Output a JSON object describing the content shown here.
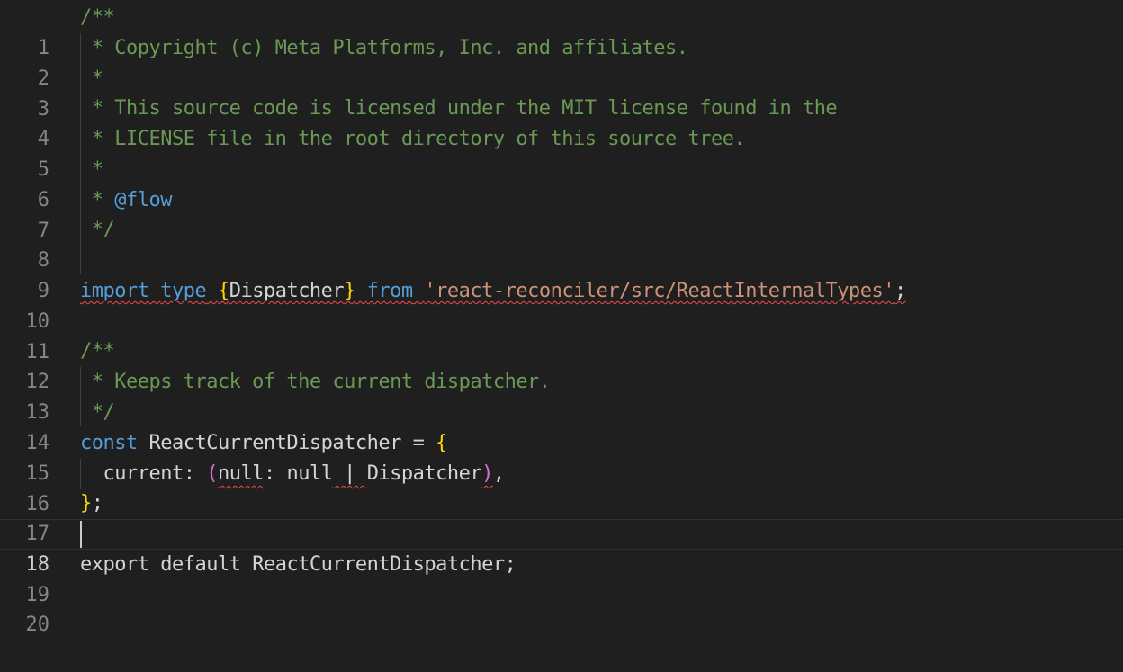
{
  "editor": {
    "current_line": 18,
    "line_numbers": [
      "1",
      "2",
      "3",
      "4",
      "5",
      "6",
      "7",
      "8",
      "9",
      "10",
      "11",
      "12",
      "13",
      "14",
      "15",
      "16",
      "17",
      "18",
      "19",
      "20"
    ],
    "lines": {
      "l1": {
        "comment": "/**"
      },
      "l2": {
        "comment": " * Copyright (c) Meta Platforms, Inc. and affiliates."
      },
      "l3": {
        "comment": " *"
      },
      "l4": {
        "comment": " * This source code is licensed under the MIT license found in the"
      },
      "l5": {
        "comment": " * LICENSE file in the root directory of this source tree."
      },
      "l6": {
        "comment": " *"
      },
      "l7": {
        "prefix": " * ",
        "tag": "@flow"
      },
      "l8": {
        "comment": " */"
      },
      "l10": {
        "kw_import": "import",
        "kw_type": "type",
        "brace_open": "{",
        "name": "Dispatcher",
        "brace_close": "}",
        "kw_from": "from",
        "path": "'react-reconciler/src/ReactInternalTypes'",
        "semi": ";"
      },
      "l12": {
        "comment": "/**"
      },
      "l13": {
        "comment": " * Keeps track of the current dispatcher."
      },
      "l14": {
        "comment": " */"
      },
      "l15": {
        "kw_const": "const",
        "name": "ReactCurrentDispatcher",
        "eq": " = ",
        "brace": "{"
      },
      "l16": {
        "indent": "  ",
        "prop": "current",
        "colon": ": ",
        "paren_open": "(",
        "null_val": "null",
        "colon2": ": ",
        "null_type": "null",
        "pipe": " | ",
        "type_name": "Dispatcher",
        "paren_close": ")",
        "comma": ","
      },
      "l17": {
        "brace": "}",
        "semi": ";"
      },
      "l19": {
        "kw_export": "export",
        "kw_default": "default",
        "name": "ReactCurrentDispatcher",
        "semi": ";"
      }
    }
  }
}
